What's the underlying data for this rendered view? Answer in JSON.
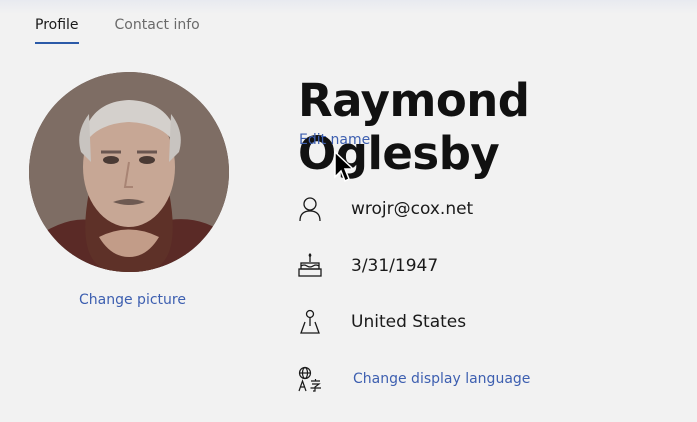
{
  "tabs": [
    {
      "label": "Profile",
      "active": true
    },
    {
      "label": "Contact info",
      "active": false
    }
  ],
  "profile": {
    "name": "Raymond Oglesby",
    "edit_name_label": "Edit name",
    "change_picture_label": "Change picture"
  },
  "details": {
    "email": {
      "icon": "person-icon",
      "value": "wrojr@cox.net"
    },
    "birthdate": {
      "icon": "birthday-cake-icon",
      "value": "3/31/1947"
    },
    "country": {
      "icon": "map-pin-icon",
      "value": "United States"
    },
    "language": {
      "icon": "language-icon",
      "label": "Change display language"
    }
  },
  "colors": {
    "accent": "#3d5fb0",
    "active_tab_underline": "#2b5aa8"
  }
}
